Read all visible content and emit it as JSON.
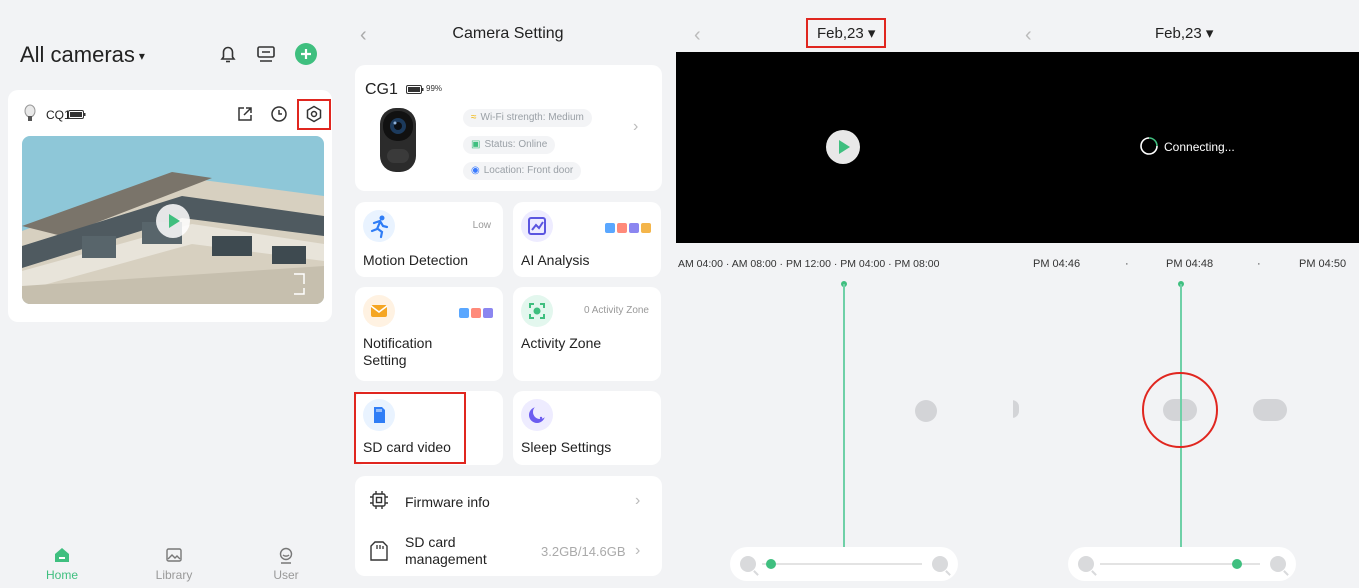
{
  "panel1": {
    "title": "All cameras",
    "caret": "▾",
    "camera_name": "CQ1",
    "tabs": [
      {
        "label": "Home"
      },
      {
        "label": "Library"
      },
      {
        "label": "User"
      }
    ],
    "accent": "#3fbf7f",
    "highlight": "#e0261f"
  },
  "panel2": {
    "back": "‹",
    "title": "Camera Setting",
    "device": {
      "name": "CG1",
      "battery": "99%",
      "wifi": "Wi-Fi strength: Medium",
      "status": "Status: Online",
      "location": "Location: Front door"
    },
    "tiles": {
      "motion": {
        "label": "Motion Detection",
        "value": "Low"
      },
      "ai": {
        "label": "AI Analysis"
      },
      "notification": {
        "label_line1": "Notification",
        "label_line2": "Setting"
      },
      "activity": {
        "label": "Activity Zone",
        "value": "0 Activity Zone"
      },
      "sd_video": {
        "label": "SD card video"
      },
      "sleep": {
        "label": "Sleep Settings"
      }
    },
    "list": {
      "firmware": {
        "label": "Firmware info"
      },
      "sd_mgmt": {
        "label_line1": "SD card",
        "label_line2": "management",
        "value": "3.2GB/14.6GB"
      }
    },
    "chevron": "›"
  },
  "panel3": {
    "back": "‹",
    "date": "Feb,23 ▾",
    "timeline": "AM 04:00  ·  AM 08:00  ·  PM 12:00  ·  PM 04:00  ·  PM 08:00"
  },
  "panel4": {
    "back": "‹",
    "date": "Feb,23 ▾",
    "connecting": "Connecting...",
    "times": [
      "PM 04:46",
      "·",
      "PM 04:48",
      "·",
      "PM 04:50"
    ]
  }
}
